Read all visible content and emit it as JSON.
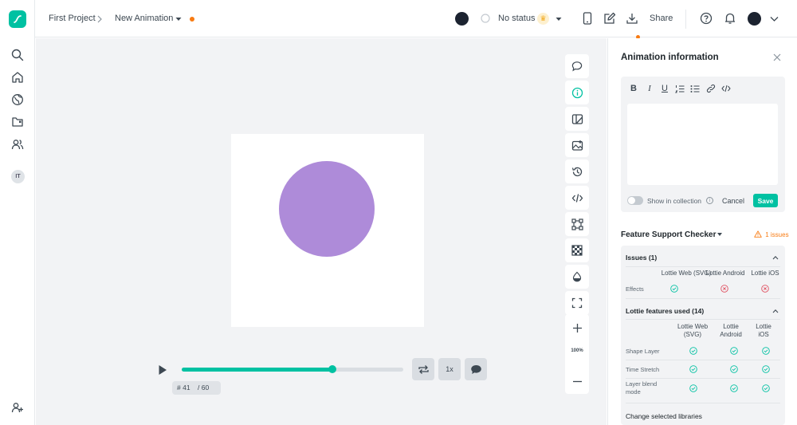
{
  "colors": {
    "accent": "#00c1a2",
    "warning": "#f87b12",
    "error": "#e04f5f",
    "shape_fill": "#ae8bd9"
  },
  "header": {
    "breadcrumb_project": "First Project",
    "breadcrumb_animation": "New Animation",
    "status": "No status",
    "share": "Share"
  },
  "sidebar": {
    "items": [
      {
        "icon": "search-icon"
      },
      {
        "icon": "home-icon"
      },
      {
        "icon": "globe-icon"
      },
      {
        "icon": "folder-icon"
      },
      {
        "icon": "users-icon"
      }
    ],
    "workspace_initials": "IT"
  },
  "canvas": {
    "zoom": "100%"
  },
  "player": {
    "current_frame": "# 41",
    "total_frames": "/ 60",
    "progress": 0.68,
    "speed": "1x"
  },
  "panel": {
    "title": "Animation information",
    "show_in_collection": "Show in collection",
    "cancel": "Cancel",
    "save": "Save",
    "feature_checker": {
      "title": "Feature Support Checker",
      "issue_count": "1 issues",
      "issues_section": {
        "title": "Issues (1)",
        "columns": [
          "Lottie Web (SVG)",
          "Lottie Android",
          "Lottie iOS"
        ],
        "rows": [
          {
            "label": "Effects",
            "support": [
              "ok",
              "fail",
              "fail"
            ]
          }
        ]
      },
      "features_section": {
        "title": "Lottie features used (14)",
        "columns": [
          "Lottie Web (SVG)",
          "Lottie Android",
          "Lottie iOS"
        ],
        "rows": [
          {
            "label": "Shape Layer",
            "support": [
              "ok",
              "ok",
              "ok"
            ]
          },
          {
            "label": "Time Stretch",
            "support": [
              "ok",
              "ok",
              "ok"
            ]
          },
          {
            "label": "Layer blend mode",
            "support": [
              "ok",
              "ok",
              "ok"
            ]
          }
        ]
      },
      "change_libraries": "Change selected libraries"
    }
  }
}
